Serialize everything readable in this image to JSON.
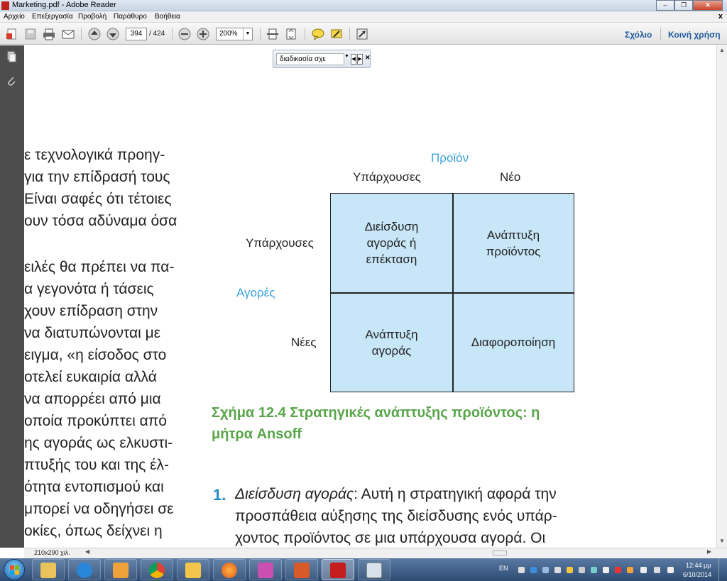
{
  "window": {
    "title": "Marketing.pdf - Adobe Reader",
    "min": "–",
    "max": "❐",
    "close": "✕"
  },
  "menu": [
    "Αρχείο",
    "Επεξεργασία",
    "Προβολή",
    "Παράθυρο",
    "Βοήθεια"
  ],
  "menu_close": "x",
  "toolbar": {
    "page_current": "394",
    "page_total": "/ 424",
    "zoom": "200%",
    "comment_label": "Σχόλιο",
    "share_label": "Κοινή χρήση"
  },
  "find": {
    "value": "διαδικασία σχε"
  },
  "document": {
    "left_lines": [
      "ε τεχνολογικά προηγ-",
      "για την επίδρασή τους",
      "Είναι σαφές ότι τέτοιες",
      "ουν τόσα αδύναμα όσα",
      "ειλές θα πρέπει να πα-",
      "α γεγονότα ή τάσεις",
      "χουν επίδραση στην",
      "να διατυπώνονται με",
      "ειγμα, «η είσοδος στο",
      "οτελεί ευκαιρία αλλά",
      "να απορρέει από μια",
      "οποία προκύπτει από",
      "ης αγοράς ως ελκυστι-",
      "πτυξής του και της έλ-",
      "ότητα εντοπισμού και",
      "μπορεί να οδηγήσει σε",
      "οκίες, όπως δείχνει η"
    ],
    "figure": {
      "product_axis": "Προϊόν",
      "market_axis": "Αγορές",
      "col_existing": "Υπάρχουσες",
      "col_new": "Νέο",
      "row_existing": "Υπάρχουσες",
      "row_new": "Νέες",
      "cell_penetration": [
        "Διείσδυση",
        "αγοράς ή",
        "επέκταση"
      ],
      "cell_product_dev": [
        "Ανάπτυξη",
        "προϊόντος"
      ],
      "cell_market_dev": [
        "Ανάπτυξη",
        "αγοράς"
      ],
      "cell_diversification": [
        "Διαφοροποίηση"
      ],
      "caption_line1": "Σχήμα 12.4  Στρατηγικές ανάπτυξης προϊόντος: η",
      "caption_line2": "μήτρα Ansoff"
    },
    "list": {
      "number": "1.",
      "term": "Διείσδυση αγοράς",
      "line1_rest": ": Αυτή η στρατηγική αφορά την",
      "line2": "προσπάθεια αύξησης της διείσδυσης ενός υπάρ-",
      "line3": "χοντος προϊόντος σε μια υπάρχουσα αγορά. Οι"
    }
  },
  "status": {
    "page_size": "210x290 χιλ."
  },
  "taskbar": {
    "lang": "EN",
    "time": "12:44 μμ",
    "date": "6/10/2014",
    "apps": [
      "explorer",
      "internet-explorer",
      "media-player",
      "chrome",
      "mail",
      "firefox",
      "keypass",
      "powerpoint",
      "adobe-reader",
      "snipping-tool"
    ]
  },
  "colors": {
    "accent_blue": "#3aa3d9",
    "caption_green": "#58a54a",
    "cell_fill": "#c7e6f7",
    "link_blue": "#1f5a9c"
  }
}
